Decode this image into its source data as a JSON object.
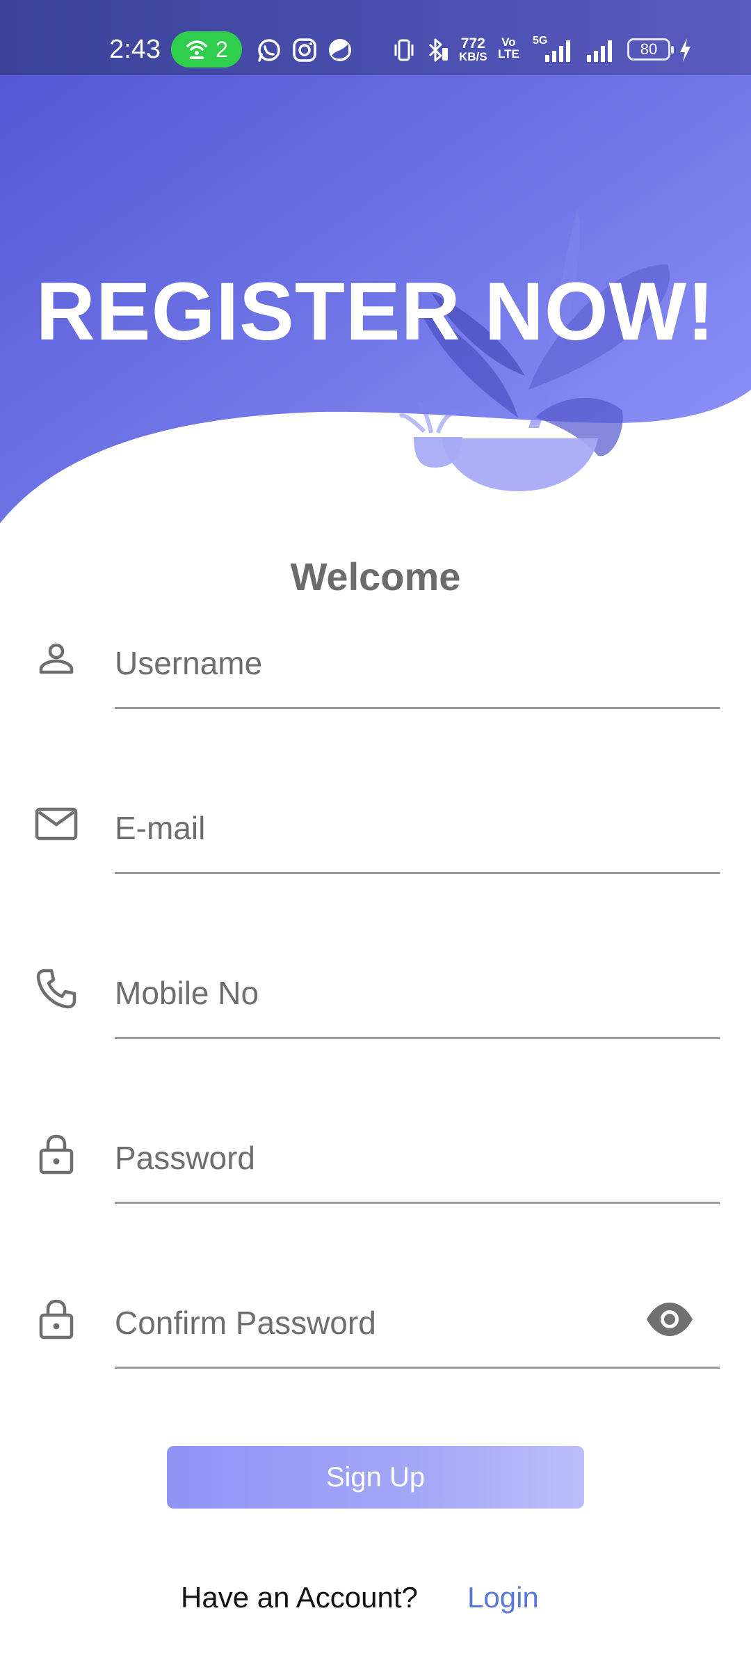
{
  "status_bar": {
    "time": "2:43",
    "hotspot_count": "2",
    "net_speed_value": "772",
    "net_speed_unit": "KB/S",
    "volte_line1": "Vo",
    "volte_line2": "LTE",
    "network_type": "5G",
    "battery": "80"
  },
  "header": {
    "title": "REGISTER NOW!"
  },
  "form": {
    "welcome": "Welcome",
    "fields": [
      {
        "placeholder": "Username",
        "value": ""
      },
      {
        "placeholder": "E-mail",
        "value": ""
      },
      {
        "placeholder": "Mobile No",
        "value": ""
      },
      {
        "placeholder": "Password",
        "value": ""
      },
      {
        "placeholder": "Confirm Password",
        "value": ""
      }
    ],
    "signup_label": "Sign Up"
  },
  "footer": {
    "prompt": "Have an Account?",
    "login_label": "Login"
  },
  "colors": {
    "header_gradient_start": "#5357d6",
    "header_gradient_end": "#8c90f8",
    "plant": "#4d52c4",
    "button_start": "#8f93f5",
    "button_end": "#bcbefa",
    "link": "#5b78d8",
    "icon_gray": "#6e6e6e"
  }
}
